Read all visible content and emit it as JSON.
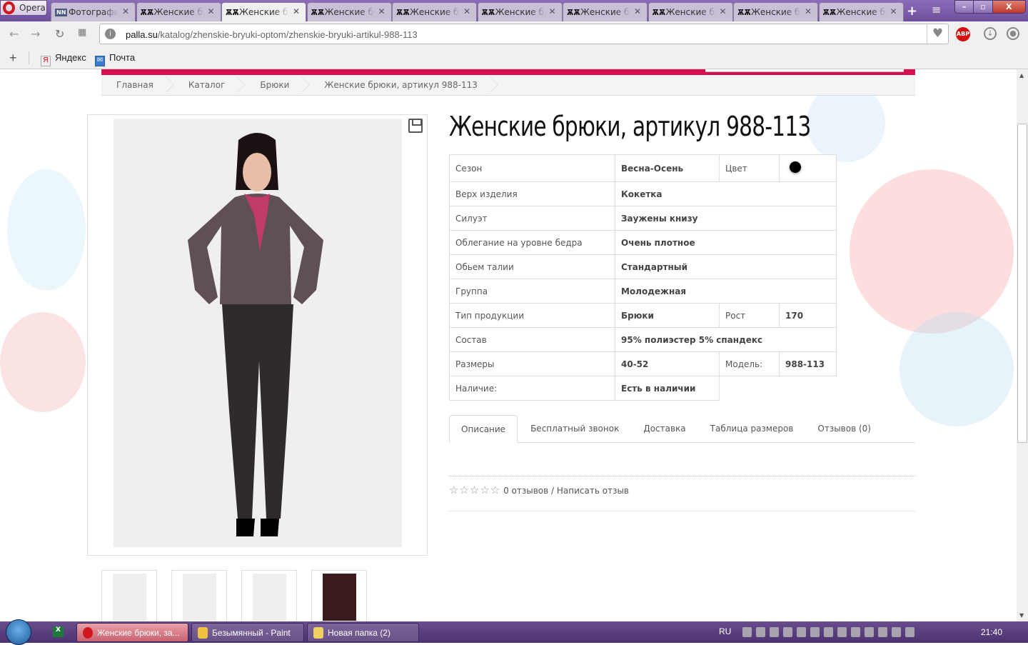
{
  "browser": {
    "menu_label": "Opera",
    "tabs": [
      {
        "label": "Фотографии",
        "favicon": "NN",
        "active": false
      },
      {
        "label": "Женские брюки",
        "active": false
      },
      {
        "label": "Женские брюки",
        "active": true
      },
      {
        "label": "Женские брюки",
        "active": false
      },
      {
        "label": "Женские брюки",
        "active": false
      },
      {
        "label": "Женские брюки",
        "active": false
      },
      {
        "label": "Женские брюки",
        "active": false
      },
      {
        "label": "Женские брюки",
        "active": false
      },
      {
        "label": "Женские брюки",
        "active": false
      },
      {
        "label": "Женские брюки",
        "active": false
      }
    ],
    "url_host": "palla.su",
    "url_path": "/katalog/zhenskie-bryuki-optom/zhenskie-bryuki-artikul-988-113",
    "abp_label": "ABP",
    "bookmarks": [
      {
        "label": "Яндекс",
        "icon": "Я"
      },
      {
        "label": "Почта",
        "icon": "mail"
      }
    ]
  },
  "page": {
    "accent": "#d80f4e",
    "breadcrumbs": [
      "Главная",
      "Каталог",
      "Брюки",
      "Женские брюки, артикул 988-113"
    ],
    "title": "Женские брюки, артикул 988-113",
    "props": {
      "season_label": "Сезон",
      "season": "Весна-Осень",
      "color_label": "Цвет",
      "color": "#000000",
      "top_label": "Верх изделия",
      "top": "Кокетка",
      "silhouette_label": "Силуэт",
      "silhouette": "Заужены книзу",
      "fit_label": "Облегание на уровне бедра",
      "fit": "Очень плотное",
      "waist_label": "Обьем талии",
      "waist": "Стандартный",
      "group_label": "Группа",
      "group": "Молодежная",
      "type_label": "Тип продукции",
      "type": "Брюки",
      "height_label": "Рост",
      "height": "170",
      "composition_label": "Состав",
      "composition": "95% полиэстер 5% спандекс",
      "sizes_label": "Размеры",
      "sizes": "40-52",
      "model_label": "Модель:",
      "model": "988-113",
      "stock_label": "Наличие:",
      "stock": "Есть в наличии"
    },
    "tabs": [
      "Описание",
      "Бесплатный звонок",
      "Доставка",
      "Таблица размеров",
      "Отзывов (0)"
    ],
    "rating": 0,
    "reviews_text": "0 отзывов / Написать отзыв"
  },
  "taskbar": {
    "items": [
      "Женские брюки, за...",
      "Безымянный - Paint",
      "Новая папка (2)"
    ],
    "lang": "RU",
    "clock": "21:40"
  }
}
